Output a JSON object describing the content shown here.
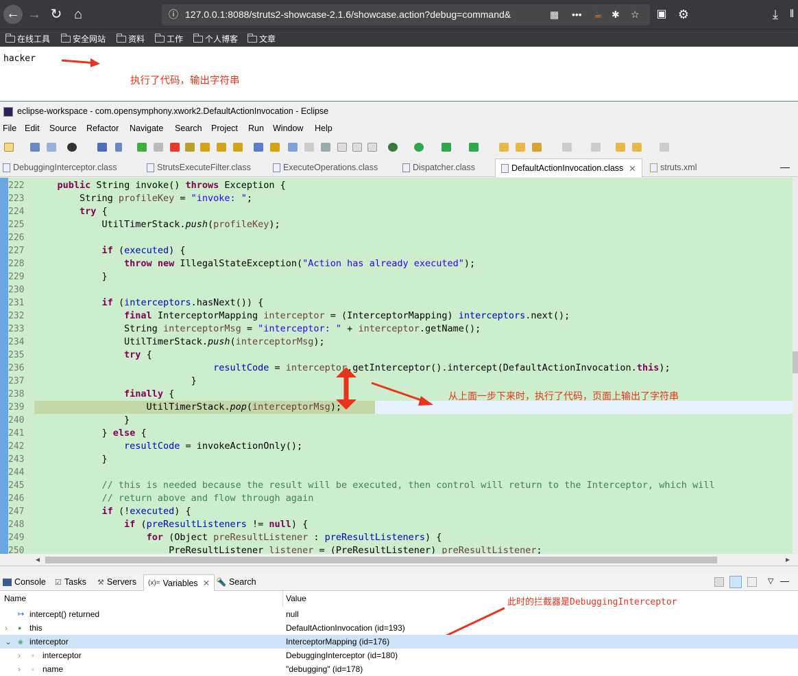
{
  "browser": {
    "url": "127.0.0.1:8088/struts2-showcase-2.1.6/showcase.action?debug=command&",
    "bookmarks": [
      "在线工具",
      "安全网站",
      "资料",
      "工作",
      "个人博客",
      "文章"
    ]
  },
  "page": {
    "output": "hacker",
    "annotation_top": "执行了代码，输出字符串"
  },
  "eclipse": {
    "title": "eclipse-workspace - com.opensymphony.xwork2.DefaultActionInvocation - Eclipse",
    "menu": [
      "File",
      "Edit",
      "Source",
      "Refactor",
      "Navigate",
      "Search",
      "Project",
      "Run",
      "Window",
      "Help"
    ],
    "tabs": [
      "DebuggingInterceptor.class",
      "StrutsExecuteFilter.class",
      "ExecuteOperations.class",
      "Dispatcher.class",
      "DefaultActionInvocation.class",
      "struts.xml"
    ],
    "line_numbers": [
      "222",
      "223",
      "224",
      "225",
      "226",
      "227",
      "228",
      "229",
      "230",
      "231",
      "232",
      "233",
      "234",
      "235",
      "236",
      "237",
      "238",
      "239",
      "240",
      "241",
      "242",
      "243",
      "244",
      "245",
      "246",
      "247",
      "248",
      "249",
      "250"
    ],
    "annotation_editor": "从上面一步下来时，执行了代码，页面上输出了字符串",
    "views": [
      "Console",
      "Tasks",
      "Servers",
      "Variables",
      "Search"
    ],
    "variables": {
      "col_name": "Name",
      "col_value": "Value",
      "annotation": "此时的拦截器是DebuggingInterceptor",
      "rows": [
        {
          "name": "intercept() returned",
          "value": "null"
        },
        {
          "name": "this",
          "value": "DefaultActionInvocation  (id=193)"
        },
        {
          "name": "interceptor",
          "value": "InterceptorMapping  (id=176)"
        },
        {
          "name": "interceptor",
          "value": "DebuggingInterceptor  (id=180)"
        },
        {
          "name": "name",
          "value": "\"debugging\" (id=178)"
        }
      ]
    }
  },
  "colors": {
    "editor_bg": "#cceecc",
    "keyword": "#7f0055",
    "field": "#0000c0",
    "string": "#2a00ff",
    "annotation": "#e8341c"
  }
}
